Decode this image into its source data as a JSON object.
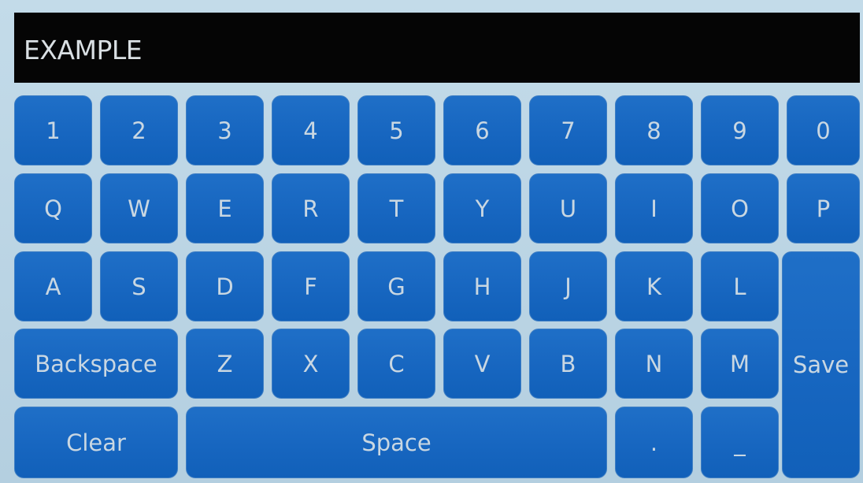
{
  "display": {
    "text": "EXAMPLE"
  },
  "keys": {
    "row1": [
      "1",
      "2",
      "3",
      "4",
      "5",
      "6",
      "7",
      "8",
      "9",
      "0"
    ],
    "row2": [
      "Q",
      "W",
      "E",
      "R",
      "T",
      "Y",
      "U",
      "I",
      "O",
      "P"
    ],
    "row3": [
      "A",
      "S",
      "D",
      "F",
      "G",
      "H",
      "J",
      "K",
      "L"
    ],
    "row4": [
      "Backspace",
      "Z",
      "X",
      "C",
      "V",
      "B",
      "N",
      "M"
    ],
    "save": "Save",
    "clear": "Clear",
    "space": "Space",
    "period": ".",
    "underscore": "_"
  },
  "colors": {
    "key_blue": "#1766c0",
    "key_text": "#c9d7e2",
    "display_bg": "#050505",
    "background": "#b9d3e3"
  }
}
